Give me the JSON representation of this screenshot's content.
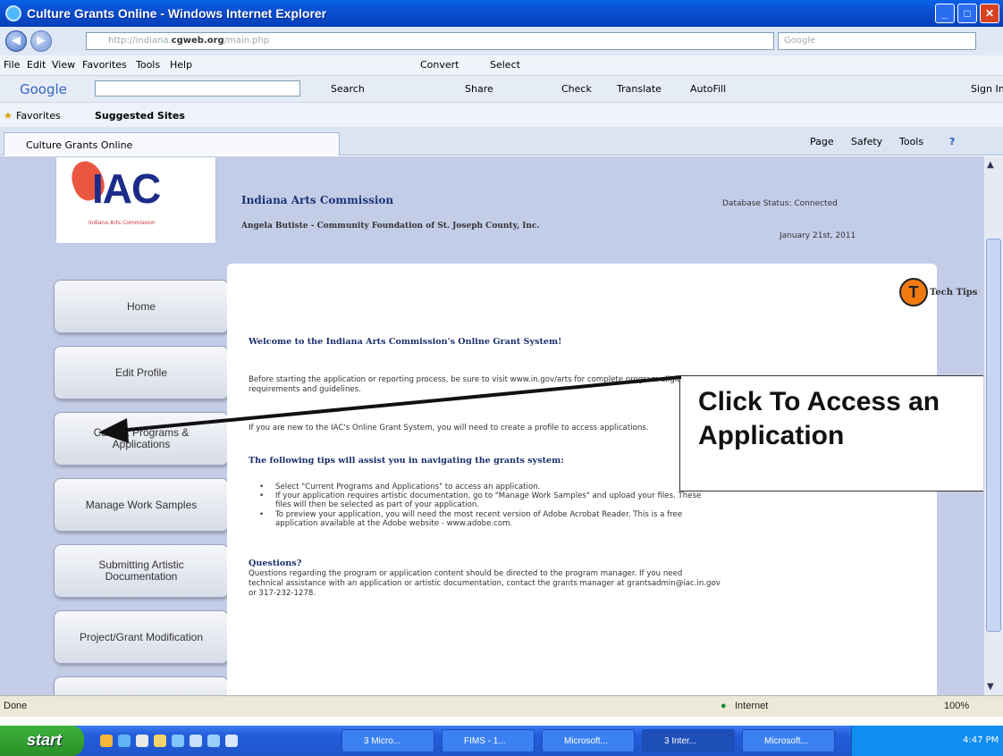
{
  "window": {
    "title": "Culture Grants Online - Windows Internet Explorer"
  },
  "address": {
    "url_prefix": "http://indiana.",
    "url_domain": "cgweb.org",
    "url_suffix": "/main.php",
    "search_placeholder": "Google"
  },
  "menu": [
    "File",
    "Edit",
    "View",
    "Favorites",
    "Tools",
    "Help"
  ],
  "menu_extras": {
    "convert": "Convert",
    "select": "Select"
  },
  "google_bar": {
    "brand": "Google",
    "search": "Search",
    "share": "Share",
    "check": "Check",
    "translate": "Translate",
    "autofill": "AutoFill",
    "signin": "Sign In"
  },
  "favorites": {
    "label": "Favorites",
    "suggested": "Suggested Sites"
  },
  "tab": {
    "title": "Culture Grants Online",
    "tools": [
      "Page",
      "Safety",
      "Tools"
    ]
  },
  "header": {
    "logo": "IAC",
    "logo_sub": "Indiana Arts Commission",
    "org": "Indiana Arts Commission",
    "user": "Angela Butiste - Community Foundation of St. Joseph County, Inc.",
    "status": "Database Status: Connected",
    "date": "January 21st, 2011"
  },
  "sidebar": [
    {
      "label": "Home"
    },
    {
      "label": "Edit Profile"
    },
    {
      "label": "Current Programs & Applications"
    },
    {
      "label": "Manage Work Samples"
    },
    {
      "label": "Submitting Artistic Documentation"
    },
    {
      "label": "Project/Grant Modification"
    }
  ],
  "content": {
    "tech_tips": "Tech Tips",
    "welcome": "Welcome to the Indiana Arts Commission's Online Grant System!",
    "para1_line1": "Before starting the application or reporting process, be sure to visit www.in.gov/arts for complete program eligibility",
    "para1_line2": "requirements and guidelines.",
    "para2": "If you are new to the IAC's Online Grant System, you will need to create a profile to access applications.",
    "tips_heading": "The following tips will assist you in navigating the grants system:",
    "bullets": [
      "Select \"Current Programs and Applications\" to access an application.",
      "If your application requires artistic documentation, go to \"Manage Work Samples\" and upload your files. These",
      "files will then be selected as part of your application.",
      "To preview your application, you will need the most recent version of Adobe Acrobat Reader. This is a free",
      "application available at the Adobe website - www.adobe.com."
    ],
    "questions_heading": "Questions?",
    "questions_lines": [
      "Questions regarding the program or application content should be directed to the program manager. If you need",
      "technical assistance with an application or artistic documentation, contact the grants manager at grantsadmin@iac.in.gov",
      "or 317-232-1278."
    ]
  },
  "callout": {
    "line1": "Click To Access an",
    "line2": "Application"
  },
  "statusbar": {
    "left": "Done",
    "zone": "Internet",
    "zoom": "100%"
  },
  "taskbar": {
    "start": "start",
    "items": [
      "3 Micro...",
      "FIMS - 1...",
      "Microsoft...",
      "3 Inter...",
      "Microsoft..."
    ],
    "clock": "4:47 PM"
  },
  "colors": {
    "titlebar": "#0a4fd0",
    "accent": "#1b3276",
    "orange": "#f07a10"
  }
}
